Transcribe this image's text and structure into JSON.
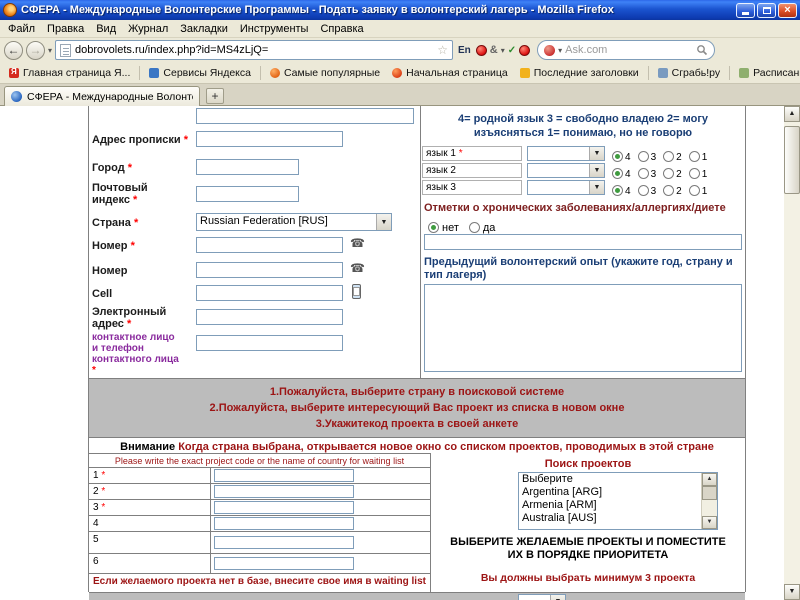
{
  "window": {
    "title": "СФЕРА - Международные Волонтерские Программы - Подать заявку в волонтерский лагерь - Mozilla Firefox"
  },
  "menubar": {
    "items": [
      "Файл",
      "Правка",
      "Вид",
      "Журнал",
      "Закладки",
      "Инструменты",
      "Справка"
    ]
  },
  "navbar": {
    "url": "dobrovolets.ru/index.php?id=MS4zLjQ=",
    "lang_indicator": "En",
    "amp_icon": "&",
    "search_placeholder": "Ask.com"
  },
  "bookmarks": {
    "items": [
      "Главная страница Я...",
      "Сервисы Яндекса",
      "Самые популярные",
      "Начальная страница",
      "Последние заголовки",
      "Сграбь!ру",
      "Расписание электри..."
    ]
  },
  "tabbar": {
    "active_tab": "СФЕРА - Международные Волонтерские П...",
    "new_tab": "+"
  },
  "form": {
    "required_mark": "*",
    "address_label": "Адрес прописки",
    "city_label": "Город",
    "postal_label": "Почтовый индекс",
    "country_label": "Страна",
    "country_value": "Russian Federation [RUS]",
    "phone1_label": "Номер",
    "phone2_label": "Номер",
    "cell_label": "Cell",
    "email_label": "Электронный адрес",
    "contact_label": "контактное лицо и телефон контактного лица"
  },
  "languages": {
    "header": "4= родной язык 3 = свободно владею 2= могу изъясняться 1= понимаю, но не говорю",
    "ratings": [
      "4",
      "3",
      "2",
      "1"
    ],
    "rows": [
      {
        "label": "язык 1",
        "required": true
      },
      {
        "label": "язык 2",
        "required": false
      },
      {
        "label": "язык 3",
        "required": false
      }
    ]
  },
  "health": {
    "title": "Отметки о хронических заболеваниях/аллергиях/диете",
    "option_no": "нет",
    "option_yes": "да"
  },
  "experience": {
    "title": "Предыдущий волонтерский опыт (укажите год, страну и тип лагеря)"
  },
  "projects": {
    "instructions": [
      "1.Пожалуйста, выберите страну в поисковой системе",
      "2.Пожалуйста, выберите интересующий Вас проект из списка в новом окне",
      "3.Укажитекод проекта в своей анкете"
    ],
    "warning_bold": "Внимание",
    "warning_text": "Когда страна выбрана, открывается новое окно со списком проектов, проводимых в этой стране",
    "table_header": "Please write the exact project code or the name of country for waiting list",
    "rows": [
      {
        "num": "1",
        "required": true
      },
      {
        "num": "2",
        "required": true
      },
      {
        "num": "3",
        "required": true
      },
      {
        "num": "4",
        "required": false
      },
      {
        "num": "5",
        "required": false
      },
      {
        "num": "6",
        "required": false
      }
    ],
    "waiting_note": "Если желаемого проекта нет в базе, внесите свое имя в waiting list",
    "search_title": "Поиск проектов",
    "search_options": [
      "Выберите",
      "Argentina [ARG]",
      "Armenia [ARM]",
      "Australia [AUS]"
    ],
    "priority_note": "ВЫБЕРИТЕ ЖЕЛАЕМЫЕ ПРОЕКТЫ И ПОМЕСТИТЕ ИХ В ПОРЯДКЕ ПРИОРИТЕТА",
    "min_note": "Вы должны выбрать минимум 3 проекта"
  },
  "colors": {
    "accent_red": "#9c1414",
    "navy": "#1a3e75",
    "purple": "#8a2b9e",
    "xp_blue": "#1b54d0"
  }
}
